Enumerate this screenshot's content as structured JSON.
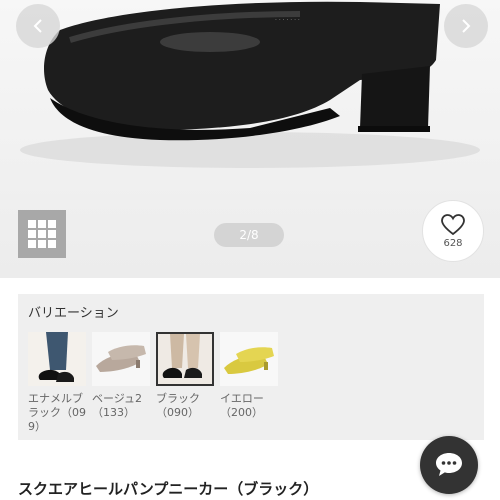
{
  "gallery": {
    "counter": "2/8",
    "like_count": "628",
    "image_label": "black low-heel pump shoe"
  },
  "variation": {
    "title": "バリエーション",
    "items": [
      {
        "label": "エナメルブラック（099）",
        "color_name": "black enamel",
        "selected": false
      },
      {
        "label": "ベージュ2（133）",
        "color_name": "beige",
        "selected": false
      },
      {
        "label": "ブラック（090）",
        "color_name": "black",
        "selected": true
      },
      {
        "label": "イエロー（200）",
        "color_name": "yellow",
        "selected": false
      }
    ]
  },
  "product": {
    "title": "スクエアヒールパンプニーカー（ブラック）"
  },
  "icons": {
    "prev": "chevron-left-icon",
    "next": "chevron-right-icon",
    "grid": "grid-icon",
    "like": "heart-icon",
    "chat": "chat-bubble-icon"
  },
  "colors": {
    "accent_dark": "#333333",
    "panel_bg": "#efefef",
    "yellow_variant": "#e0cf45",
    "beige_variant": "#b8a89c"
  }
}
